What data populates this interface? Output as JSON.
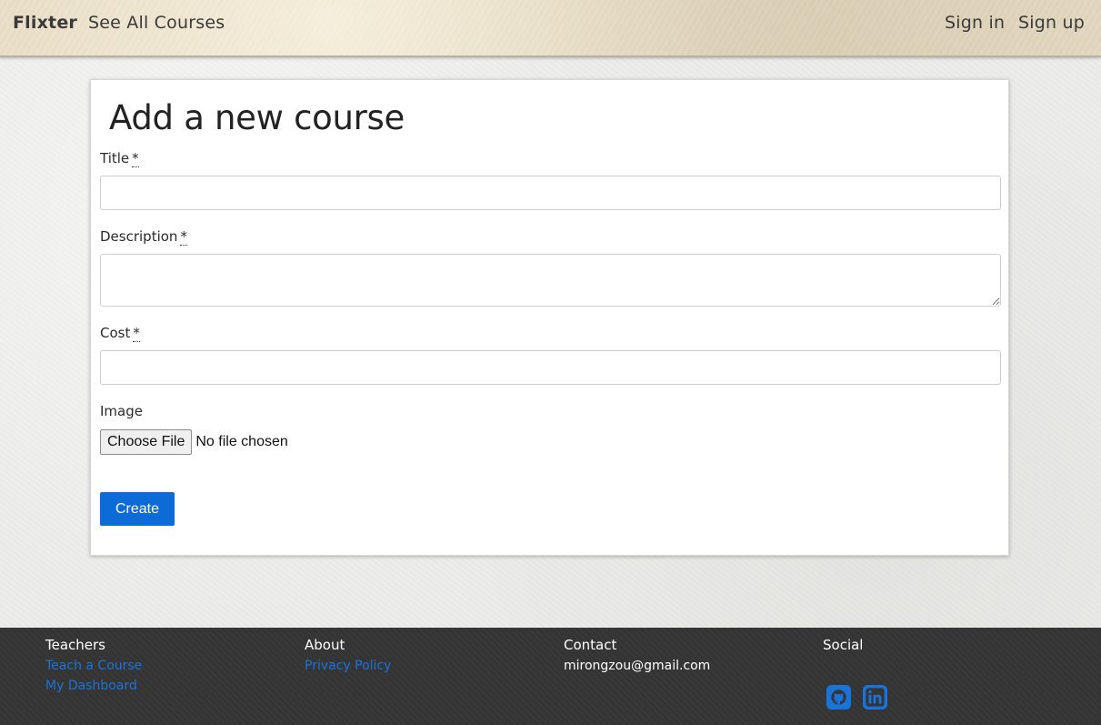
{
  "navbar": {
    "brand": "Flixter",
    "all_courses": "See All Courses",
    "sign_in": "Sign in",
    "sign_up": "Sign up"
  },
  "form": {
    "title": "Add a new course",
    "required_marker": "*",
    "title_label": "Title",
    "title_value": "",
    "description_label": "Description",
    "description_value": "",
    "cost_label": "Cost",
    "cost_value": "",
    "image_label": "Image",
    "file_button": "Choose File",
    "file_status": "No file chosen",
    "submit_label": "Create"
  },
  "footer": {
    "teachers": {
      "heading": "Teachers",
      "links": [
        "Teach a Course",
        "My Dashboard"
      ]
    },
    "about": {
      "heading": "About",
      "links": [
        "Privacy Policy"
      ]
    },
    "contact": {
      "heading": "Contact",
      "email": "mirongzou@gmail.com"
    },
    "social": {
      "heading": "Social",
      "icons": [
        "github-icon",
        "linkedin-icon"
      ]
    }
  },
  "colors": {
    "accent": "#0d6bd8",
    "link": "#1a73d9",
    "footer_bg": "#353535",
    "navbar_bg": "#e7dcc4"
  }
}
